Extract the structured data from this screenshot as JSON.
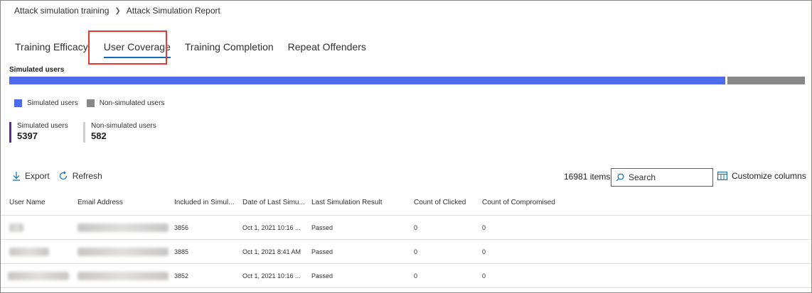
{
  "breadcrumb": {
    "root": "Attack simulation training",
    "current": "Attack Simulation Report"
  },
  "tabs": [
    {
      "label": "Training Efficacy",
      "active": false
    },
    {
      "label": "User Coverage",
      "active": true
    },
    {
      "label": "Training Completion",
      "active": false
    },
    {
      "label": "Repeat Offenders",
      "active": false
    }
  ],
  "chart_data": {
    "type": "bar",
    "title": "Simulated users",
    "categories": [
      "Simulated users",
      "Non-simulated users"
    ],
    "values": [
      5397,
      582
    ],
    "colors": [
      "#4f6bed",
      "#8a8886"
    ],
    "stacked": true,
    "legend_position": "bottom-left"
  },
  "legend": {
    "simulated": "Simulated users",
    "non_simulated": "Non-simulated users"
  },
  "kpis": {
    "simulated": {
      "label": "Simulated users",
      "value": "5397"
    },
    "non_simulated": {
      "label": "Non-simulated users",
      "value": "582"
    }
  },
  "toolbar": {
    "export": "Export",
    "refresh": "Refresh",
    "items": "16981 items",
    "search_placeholder": "Search",
    "customize": "Customize columns"
  },
  "columns": [
    "User Name",
    "Email Address",
    "Included in Simul...",
    "Date of Last Simu...",
    "Last Simulation Result",
    "Count of Clicked",
    "Count of Compromised"
  ],
  "rows": [
    {
      "included": "3856",
      "date": "Oct 1, 2021 10:16 ...",
      "result": "Passed",
      "clicked": "0",
      "compromised": "0"
    },
    {
      "included": "3885",
      "date": "Oct 1, 2021 8:41 AM",
      "result": "Passed",
      "clicked": "0",
      "compromised": "0"
    },
    {
      "included": "3852",
      "date": "Oct 1, 2021 10:16 ...",
      "result": "Passed",
      "clicked": "0",
      "compromised": "0"
    }
  ],
  "icons": {
    "export": "download-icon",
    "refresh": "refresh-icon",
    "search": "search-icon",
    "customize": "columns-icon"
  }
}
